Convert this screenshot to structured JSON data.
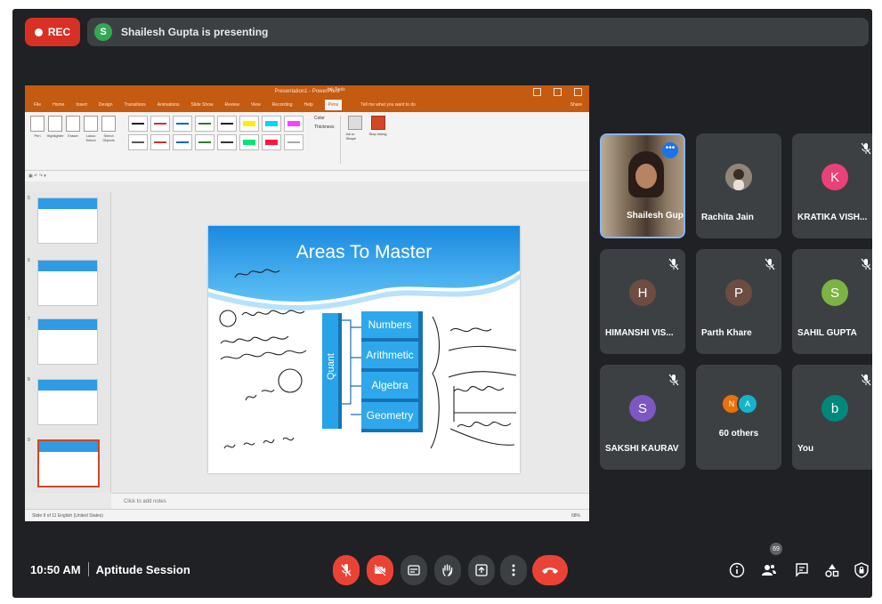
{
  "meeting": {
    "rec_label": "REC",
    "presenter_initial": "S",
    "presenter_text": "Shailesh Gupta is presenting",
    "time": "10:50 AM",
    "title": "Aptitude Session",
    "people_count": "69"
  },
  "powerpoint": {
    "window_title": "Presentation1 - PowerPoint",
    "context_tab": "Ink Tools",
    "menu": [
      "File",
      "Home",
      "Insert",
      "Design",
      "Transitions",
      "Animations",
      "Slide Show",
      "Review",
      "View",
      "Recording",
      "Help",
      "Pens"
    ],
    "active_menu": "Pens",
    "tell_me": "Tell me what you want to do",
    "share": "Share",
    "ribbon_tools": [
      {
        "label": "Pen"
      },
      {
        "label": "Highlighter"
      },
      {
        "label": "Eraser"
      },
      {
        "label": "Lasso Select"
      },
      {
        "label": "Select Objects"
      }
    ],
    "ribbon_options": [
      "Color",
      "Thickness"
    ],
    "ribbon_buttons": [
      {
        "label": "Ink to Shape"
      },
      {
        "label": "Stop Inking"
      }
    ],
    "slide_numbers": [
      "5",
      "6",
      "7",
      "8",
      "9"
    ],
    "notes_placeholder": "Click to add notes",
    "status_text": "Slide 9 of 11   English (United States)",
    "zoom": "68%"
  },
  "slide": {
    "title": "Areas To Master",
    "category": "Quant",
    "topics": [
      "Numbers",
      "Arithmetic",
      "Algebra",
      "Geometry"
    ]
  },
  "participants": [
    {
      "name": "Shailesh Gupta",
      "initial": "",
      "color": "",
      "video": true
    },
    {
      "name": "Rachita Jain",
      "initial": "",
      "color": "#7a6f63",
      "photo": true
    },
    {
      "name": "KRATIKA VISH...",
      "initial": "K",
      "color": "#ec407a"
    },
    {
      "name": "HIMANSHI VIS...",
      "initial": "H",
      "color": "#6d4c41"
    },
    {
      "name": "Parth Khare",
      "initial": "P",
      "color": "#6d4c41"
    },
    {
      "name": "SAHIL GUPTA",
      "initial": "S",
      "color": "#7cb342"
    },
    {
      "name": "SAKSHI KAURAV",
      "initial": "S",
      "color": "#7e57c2"
    },
    {
      "name": "60 others",
      "initials": [
        "N",
        "A"
      ],
      "colors": [
        "#e8710a",
        "#12b5cb"
      ]
    },
    {
      "name": "You",
      "initial": "b",
      "color": "#00897b"
    }
  ],
  "colors": {
    "background": "#202124",
    "tile": "#3c4043",
    "danger": "#ea4335",
    "accent": "#1a73e8",
    "ppt_orange": "#c55a11"
  },
  "icons": [
    "mic-off-icon",
    "camera-off-icon",
    "captions-icon",
    "raise-hand-icon",
    "present-icon",
    "more-vert-icon",
    "call-end-icon",
    "info-icon",
    "people-icon",
    "chat-icon",
    "activities-icon",
    "host-controls-icon"
  ]
}
